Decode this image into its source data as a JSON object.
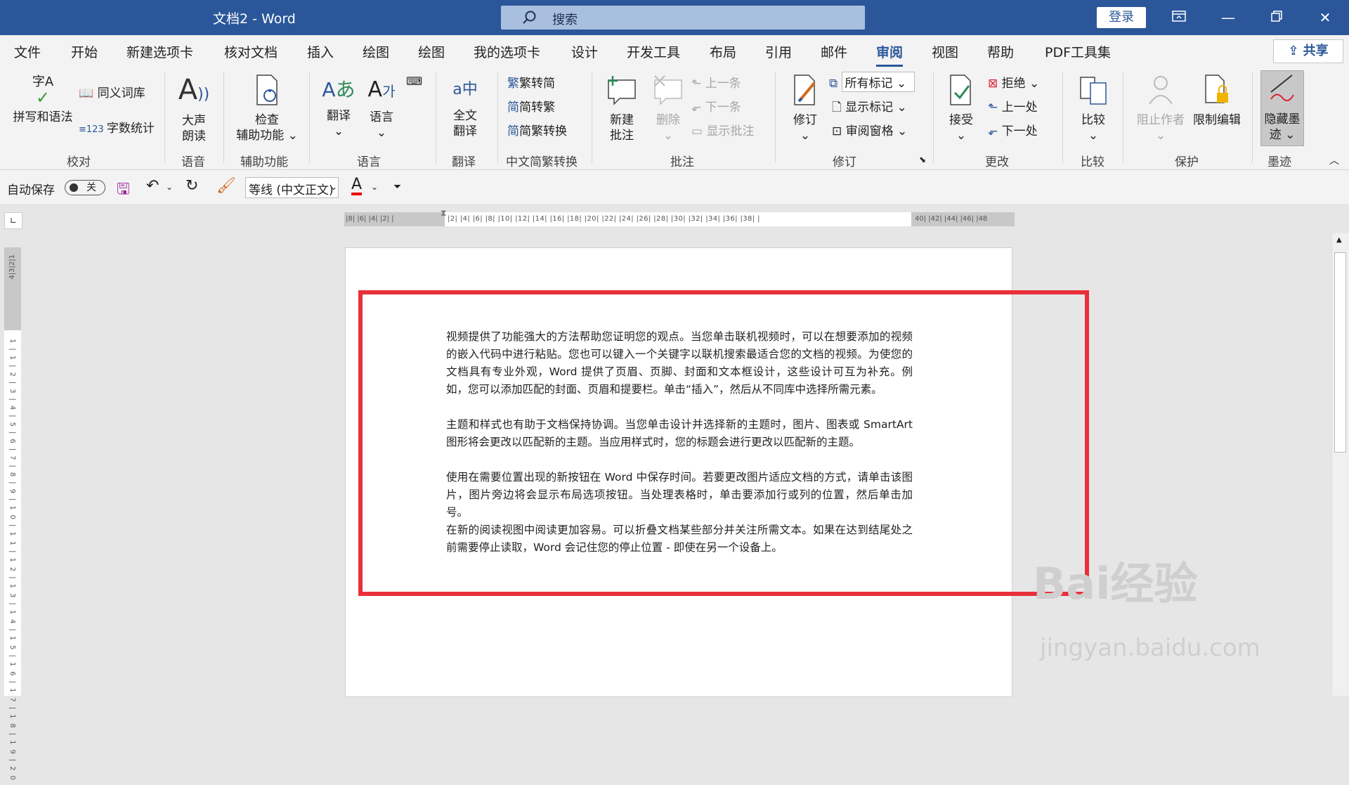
{
  "window": {
    "title": "文档2  -  Word",
    "login": "登录"
  },
  "search": {
    "label": "搜索"
  },
  "menu": [
    "文件",
    "开始",
    "新建选项卡",
    "核对文档",
    "插入",
    "绘图",
    "绘图",
    "我的选项卡",
    "设计",
    "开发工具",
    "布局",
    "引用",
    "邮件",
    "审阅",
    "视图",
    "帮助",
    "PDF工具集"
  ],
  "share": "共享",
  "ribbon": {
    "proof": {
      "spell": "拼写和语法",
      "thesaurus": "同义词库",
      "wordcount": "字数统计",
      "label": "校对",
      "spell_icon_text": "字A"
    },
    "speech": {
      "readaloud_1": "大声",
      "readaloud_2": "朗读",
      "label": "语音"
    },
    "access": {
      "check_1": "检查",
      "check_2": "辅助功能",
      "label": "辅助功能"
    },
    "lang": {
      "translate": "翻译",
      "language": "语言",
      "label": "语言"
    },
    "trans": {
      "full_1": "全文",
      "full_2": "翻译",
      "label": "翻译"
    },
    "zh": {
      "to_trad": "繁转简",
      "to_simp": "简转繁",
      "convert": "简繁转换",
      "label": "中文简繁转换"
    },
    "comments": {
      "new_1": "新建",
      "new_2": "批注",
      "delete": "删除",
      "prev": "上一条",
      "next": "下一条",
      "show": "显示批注",
      "label": "批注"
    },
    "track": {
      "revise": "修订",
      "markup": "所有标记",
      "show_markup": "显示标记",
      "pane": "审阅窗格",
      "label": "修订"
    },
    "changes": {
      "accept": "接受",
      "reject": "拒绝",
      "prev": "上一处",
      "next": "下一处",
      "label": "更改"
    },
    "compare": {
      "compare": "比较",
      "label": "比较"
    },
    "protect": {
      "block": "阻止作者",
      "restrict": "限制编辑",
      "label": "保护"
    },
    "ink": {
      "hide_1": "隐藏墨",
      "hide_2": "迹",
      "label": "墨迹"
    }
  },
  "qat": {
    "autosave": "自动保存",
    "toggle": "关",
    "font": "等线 (中文正文)"
  },
  "ruler": {
    "h_left": "|8| |6| |4| |2| |",
    "h_main": "|2| |4| |6| |8| |10| |12| |14| |16| |18| |20| |22| |24| |26| |28| |30| |32| |34| |36| |38| |",
    "h_right": "40| |42| |44| |46| |48",
    "v_top": "4|3|2|1",
    "v_main": "1|1|2|3|4|5|6|7|8|9|10|11|12|13|14|15|16|17|18|19|20"
  },
  "document": {
    "paragraphs": [
      "视频提供了功能强大的方法帮助您证明您的观点。当您单击联机视频时，可以在想要添加的视频的嵌入代码中进行粘贴。您也可以键入一个关键字以联机搜索最适合您的文档的视频。为使您的文档具有专业外观，Word 提供了页眉、页脚、封面和文本框设计，这些设计可互为补充。例如，您可以添加匹配的封面、页眉和提要栏。单击“插入”，然后从不同库中选择所需元素。",
      "主题和样式也有助于文档保持协调。当您单击设计并选择新的主题时，图片、图表或 SmartArt 图形将会更改以匹配新的主题。当应用样式时，您的标题会进行更改以匹配新的主题。",
      "使用在需要位置出现的新按钮在 Word 中保存时间。若要更改图片适应文档的方式，请单击该图片，图片旁边将会显示布局选项按钮。当处理表格时，单击要添加行或列的位置，然后单击加号。",
      "在新的阅读视图中阅读更加容易。可以折叠文档某些部分并关注所需文本。如果在达到结尾处之前需要停止读取，Word 会记住您的停止位置 - 即使在另一个设备上。"
    ]
  },
  "watermark": {
    "brand": "Bai经验",
    "url": "jingyan.baidu.com"
  },
  "colors": {
    "accent": "#2b579a",
    "highlight_box": "#e8303a"
  }
}
